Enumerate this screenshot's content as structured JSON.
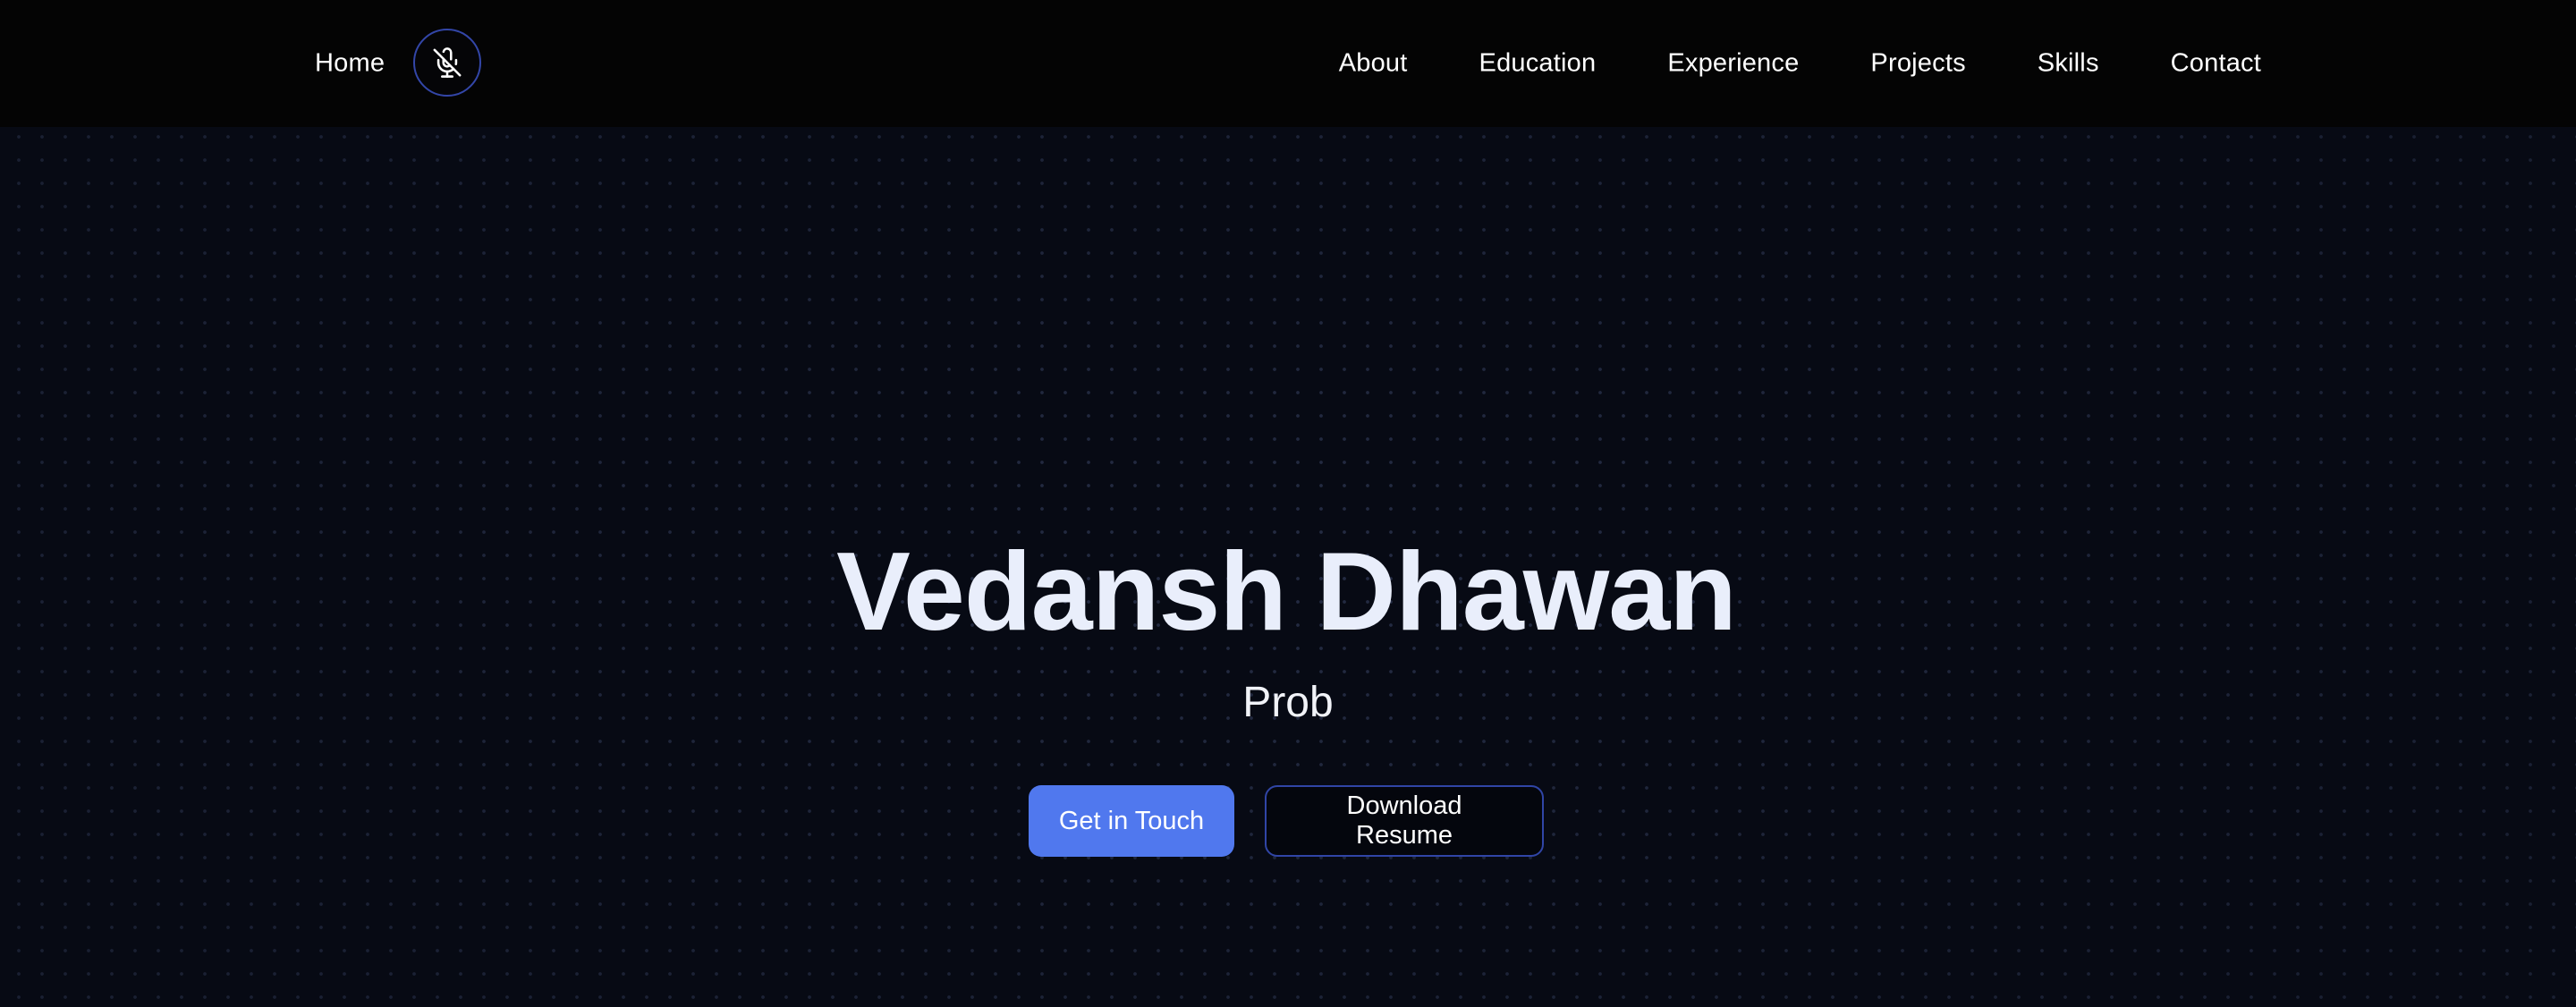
{
  "nav": {
    "home_label": "Home",
    "mic_icon": "mic-off-icon",
    "links": [
      "About",
      "Education",
      "Experience",
      "Projects",
      "Skills",
      "Contact"
    ]
  },
  "hero": {
    "name": "Vedansh Dhawan",
    "subtitle": "Prob",
    "primary_button": "Get in Touch",
    "secondary_button": "Download Resume"
  },
  "colors": {
    "background": "#070a14",
    "navbar": "#040404",
    "accent": "#5078ee",
    "outline": "#3045a6",
    "heading": "#e9eefb"
  }
}
